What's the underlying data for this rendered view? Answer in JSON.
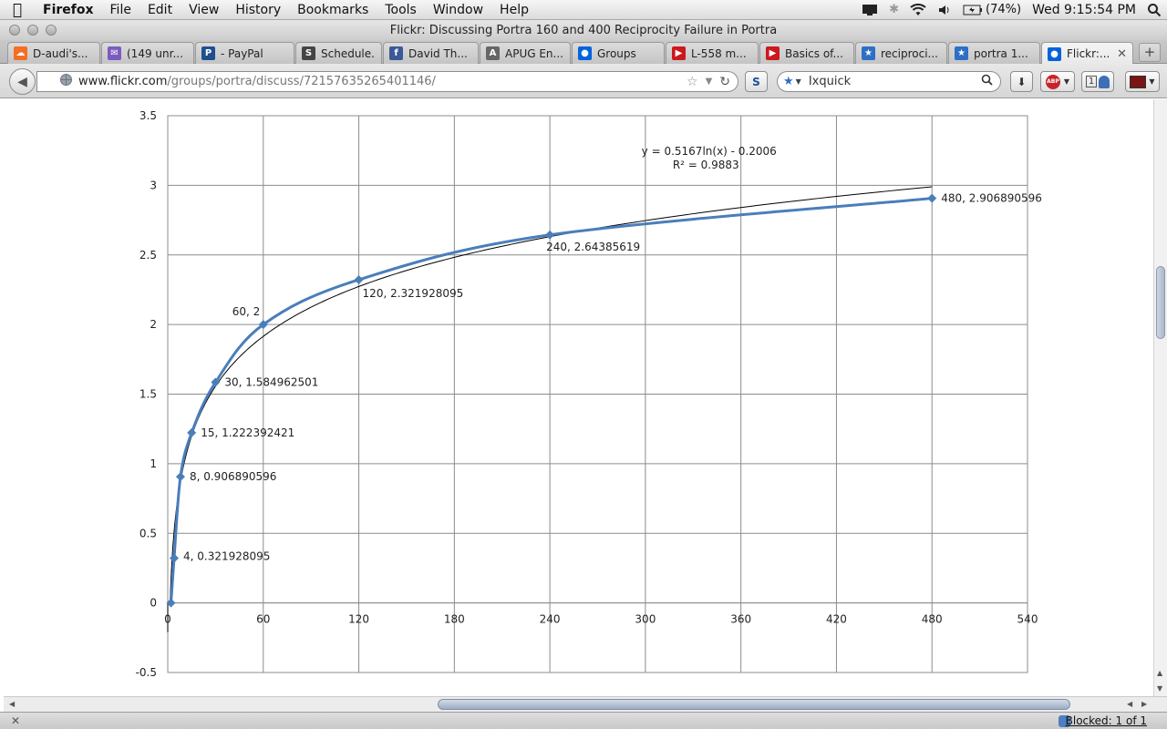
{
  "menubar": {
    "app_name": "Firefox",
    "items": [
      "File",
      "Edit",
      "View",
      "History",
      "Bookmarks",
      "Tools",
      "Window",
      "Help"
    ],
    "battery": "(74%)",
    "clock": "Wed 9:15:54 PM"
  },
  "window": {
    "title": "Flickr: Discussing Portra 160 and 400 Reciprocity Failure in Portra"
  },
  "tabs": [
    {
      "label": "D-audi's...",
      "icon": "soundcloud-icon",
      "color": "#f26f23"
    },
    {
      "label": "(149 unr...",
      "icon": "mail-icon",
      "color": "#7c5bbf"
    },
    {
      "label": "- PayPal",
      "icon": "paypal-icon",
      "color": "#1f4f8f"
    },
    {
      "label": "Schedule...",
      "icon": "site-icon",
      "color": "#444444"
    },
    {
      "label": "David Th...",
      "icon": "facebook-icon",
      "color": "#3b5998"
    },
    {
      "label": "APUG En...",
      "icon": "apug-icon",
      "color": "#666666"
    },
    {
      "label": "Groups",
      "icon": "flickr-icon",
      "color": "#0063dc"
    },
    {
      "label": "L-558 m...",
      "icon": "youtube-icon",
      "color": "#cc181e"
    },
    {
      "label": "Basics of...",
      "icon": "youtube-icon",
      "color": "#cc181e"
    },
    {
      "label": "reciproci...",
      "icon": "star-icon",
      "color": "#2d6fc6"
    },
    {
      "label": "portra 1...",
      "icon": "star-icon",
      "color": "#2d6fc6"
    },
    {
      "label": "Flickr:...",
      "icon": "flickr-icon",
      "color": "#0063dc"
    }
  ],
  "nav": {
    "url_host": "www.flickr.com",
    "url_path": "/groups/portra/discuss/72157635265401146/",
    "search_engine": "Ixquick",
    "badge_count": "1"
  },
  "status": {
    "blocked": "Blocked: 1 of 1"
  },
  "chart_data": {
    "type": "scatter",
    "series": [
      {
        "x": [
          2,
          4,
          8,
          15,
          30,
          60,
          120,
          240,
          480
        ],
        "y": [
          0,
          0.321928095,
          0.906890596,
          1.222392421,
          1.584962501,
          2,
          2.321928095,
          2.64385619,
          2.906890596
        ],
        "color": "#4a7ebb",
        "markers": "diamond",
        "line": "smooth"
      }
    ],
    "data_labels": [
      "",
      "4, 0.321928095",
      "8, 0.906890596",
      "15, 1.222392421",
      "30, 1.584962501",
      "60, 2",
      "120, 2.321928095",
      "240, 2.64385619",
      "480, 2.906890596"
    ],
    "trendline": {
      "equation": "y = 0.5167ln(x) - 0.2006",
      "r_squared": "R² = 0.9883",
      "a": 0.5167,
      "b": -0.2006,
      "color": "#000000"
    },
    "x_ticks": [
      "0",
      "60",
      "120",
      "180",
      "240",
      "300",
      "360",
      "420",
      "480",
      "540"
    ],
    "y_ticks": [
      "3.5",
      "3",
      "2.5",
      "2",
      "1.5",
      "1",
      "0.5",
      "0",
      "-0.5"
    ],
    "xlim": [
      0,
      540
    ],
    "ylim": [
      -0.5,
      3.5
    ],
    "grid": true
  }
}
